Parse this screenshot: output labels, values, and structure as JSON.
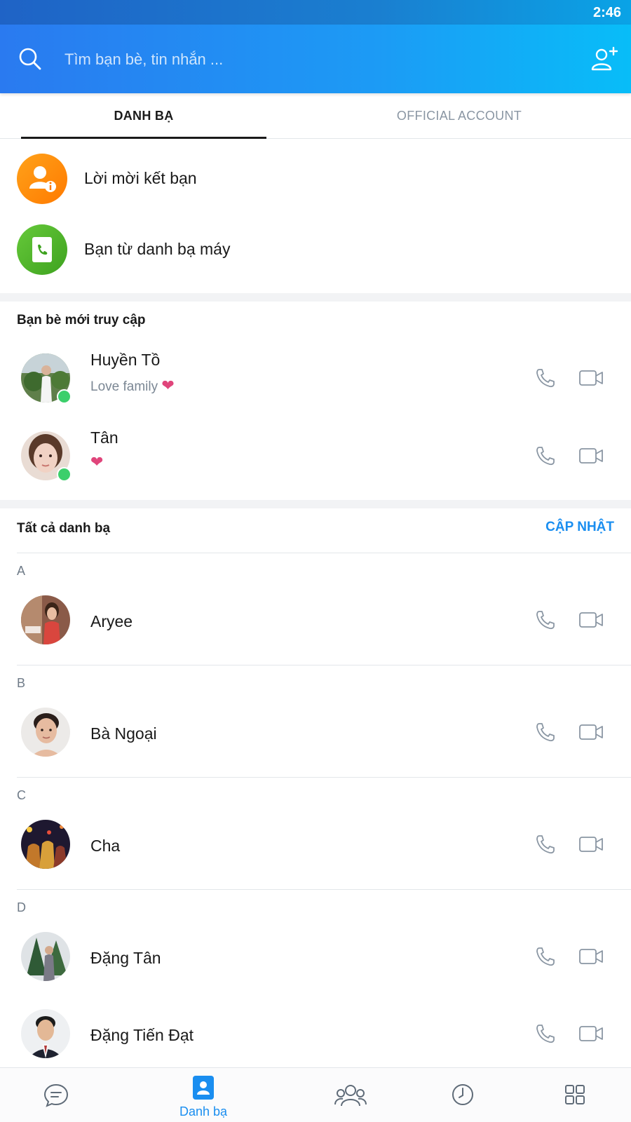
{
  "status_bar": {
    "time": "2:46"
  },
  "header": {
    "search_placeholder": "Tìm bạn bè, tin nhắn ...",
    "search_icon": "search-icon",
    "add_friend_icon": "add-friend-icon"
  },
  "tabs": [
    {
      "label": "DANH BẠ",
      "active": true
    },
    {
      "label": "OFFICIAL ACCOUNT",
      "active": false
    }
  ],
  "quick_actions": [
    {
      "label": "Lời mời kết bạn",
      "icon": "friend-request-icon",
      "color": "#ff8a00"
    },
    {
      "label": "Bạn từ danh bạ máy",
      "icon": "phonebook-icon",
      "color": "#4cb42d"
    }
  ],
  "recent_section": {
    "title": "Bạn bè mới truy cập",
    "contacts": [
      {
        "name": "Huyền Tồ",
        "status": "Love family",
        "heart": "❤",
        "online": true
      },
      {
        "name": "Tân",
        "status": "",
        "heart": "❤",
        "online": true
      }
    ]
  },
  "all_section": {
    "title": "Tất cả danh bạ",
    "update_label": "CẬP NHẬT",
    "groups": [
      {
        "letter": "A",
        "contacts": [
          {
            "name": "Aryee"
          }
        ]
      },
      {
        "letter": "B",
        "contacts": [
          {
            "name": "Bà Ngoại"
          }
        ]
      },
      {
        "letter": "C",
        "contacts": [
          {
            "name": "Cha"
          }
        ]
      },
      {
        "letter": "D",
        "contacts": [
          {
            "name": "Đặng Tân"
          },
          {
            "name": "Đặng Tiến Đạt"
          }
        ]
      }
    ]
  },
  "bottom_nav": [
    {
      "id": "messages",
      "icon": "chat-icon",
      "label": ""
    },
    {
      "id": "contacts",
      "icon": "contacts-icon",
      "label": "Danh bạ",
      "active": true
    },
    {
      "id": "groups",
      "icon": "groups-icon",
      "label": ""
    },
    {
      "id": "timeline",
      "icon": "clock-icon",
      "label": ""
    },
    {
      "id": "more",
      "icon": "grid-icon",
      "label": ""
    }
  ],
  "colors": {
    "accent": "#1a8ef0",
    "online": "#3ccf6b",
    "heart": "#e0457b"
  }
}
